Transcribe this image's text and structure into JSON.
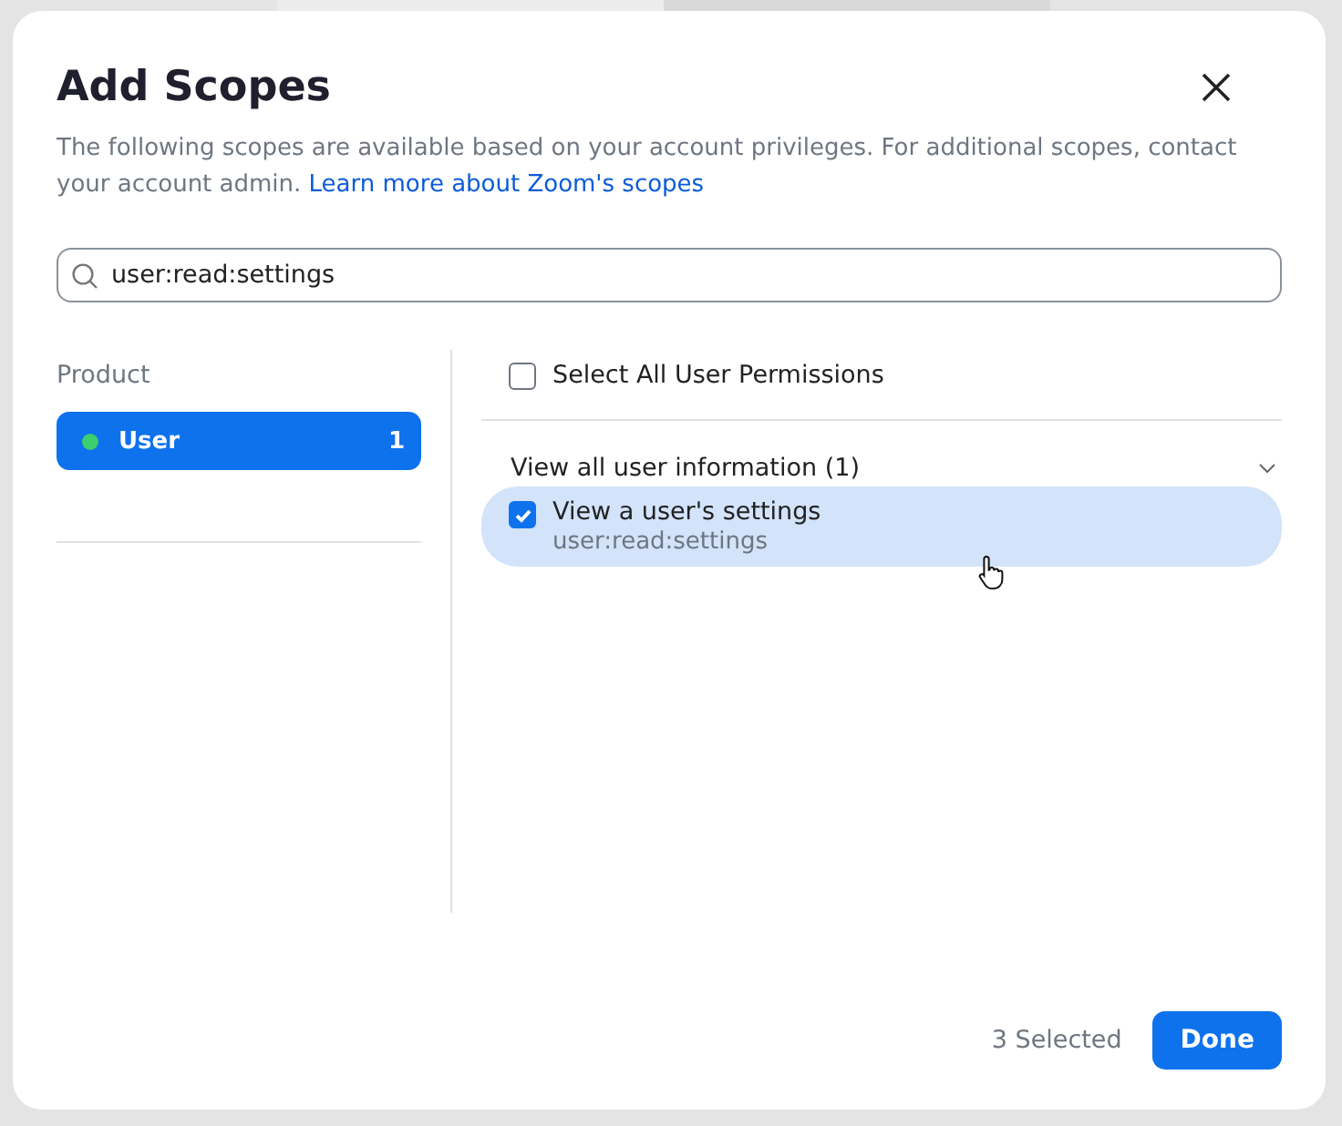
{
  "background_tabs": [
    {
      "selected": true
    },
    {
      "selected": false
    }
  ],
  "dialog": {
    "title": "Add Scopes",
    "description": "The following scopes are available based on your account privileges. For additional scopes, contact your account admin.",
    "link": "Learn more about Zoom's scopes"
  },
  "search": {
    "value": "user:read:settings"
  },
  "sidebar": {
    "heading": "Product",
    "items": [
      {
        "label": "User",
        "count": "1",
        "selected": true,
        "color": "#3ccf6e"
      }
    ]
  },
  "select_all": {
    "label": "Select All User Permissions",
    "checked": false
  },
  "groups": [
    {
      "title": "View all user information (1)",
      "expanded": true,
      "scopes": [
        {
          "label": "View a user's settings",
          "scope": "user:read:settings",
          "checked": true,
          "selected": true
        }
      ]
    }
  ],
  "footer": {
    "selected_count": "3 Selected",
    "button": "Done"
  }
}
